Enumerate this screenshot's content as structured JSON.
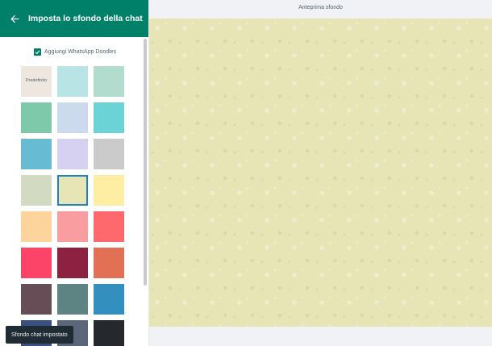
{
  "sidebar": {
    "title": "Imposta lo sfondo della chat",
    "doodles_label": "Aggiungi WhatsApp Doodles",
    "doodles_checked": true,
    "swatches": [
      {
        "color": "#ede7df",
        "label": "Predefinito"
      },
      {
        "color": "#b9e4e6",
        "label": ""
      },
      {
        "color": "#b2dcce",
        "label": ""
      },
      {
        "color": "#7ec9a9",
        "label": ""
      },
      {
        "color": "#ccdaee",
        "label": ""
      },
      {
        "color": "#6bd3d6",
        "label": ""
      },
      {
        "color": "#67bbd2",
        "label": ""
      },
      {
        "color": "#d7d1f1",
        "label": ""
      },
      {
        "color": "#cbcbcb",
        "label": ""
      },
      {
        "color": "#d2dac2",
        "label": ""
      },
      {
        "color": "#e7e4b5",
        "label": "",
        "selected": true
      },
      {
        "color": "#fdeea3",
        "label": ""
      },
      {
        "color": "#fdd49c",
        "label": ""
      },
      {
        "color": "#f99da1",
        "label": ""
      },
      {
        "color": "#fe696d",
        "label": ""
      },
      {
        "color": "#fc4468",
        "label": ""
      },
      {
        "color": "#8d2142",
        "label": ""
      },
      {
        "color": "#e27054",
        "label": ""
      },
      {
        "color": "#664d56",
        "label": ""
      },
      {
        "color": "#5d8482",
        "label": ""
      },
      {
        "color": "#338fbe",
        "label": ""
      },
      {
        "color": "#3a5180",
        "label": ""
      },
      {
        "color": "#5b6679",
        "label": ""
      },
      {
        "color": "#25282d",
        "label": ""
      }
    ]
  },
  "toast": {
    "text": "Sfondo chat impostato"
  },
  "preview": {
    "title": "Anteprima sfondo",
    "color": "#e7e4b5"
  }
}
